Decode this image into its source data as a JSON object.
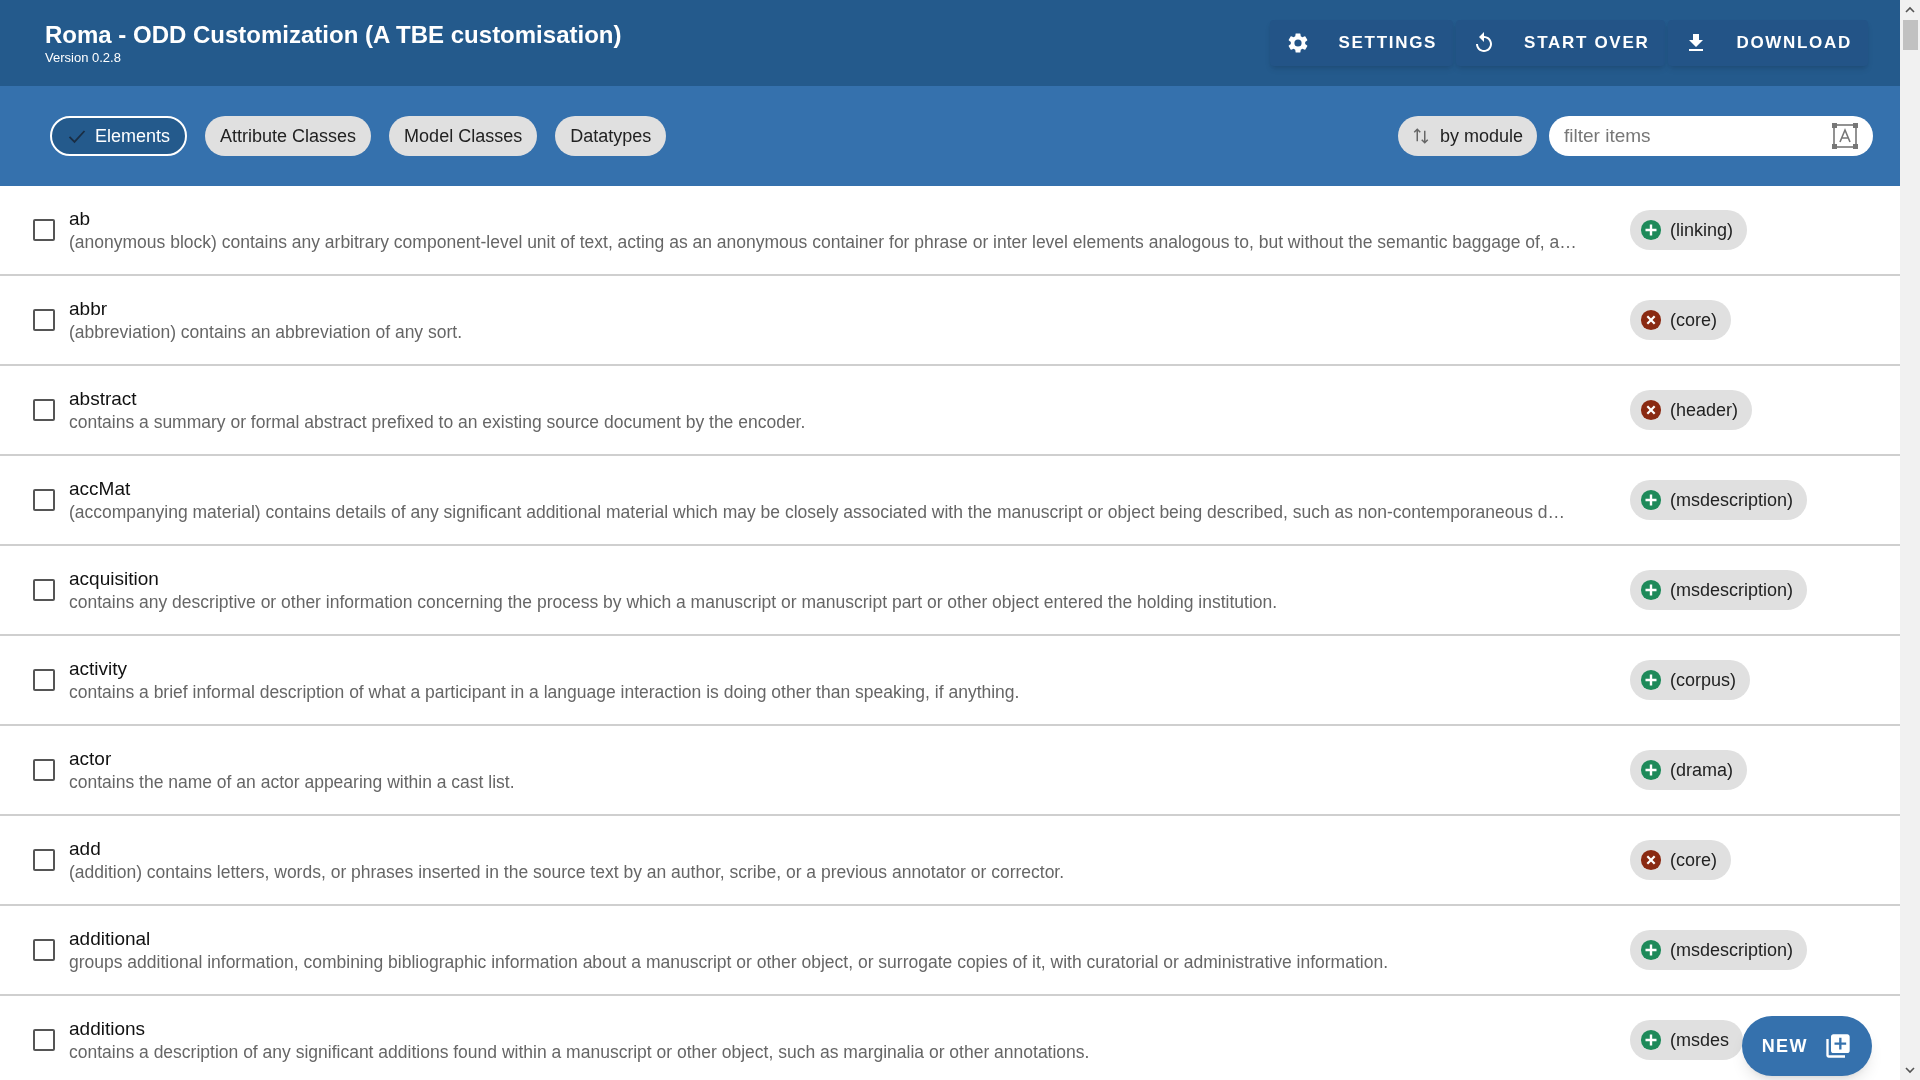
{
  "header": {
    "title": "Roma - ODD Customization (A TBE customisation)",
    "version": "Version 0.2.8",
    "actions": [
      {
        "kind": "settings",
        "label": "SETTINGS"
      },
      {
        "kind": "restart",
        "label": "START OVER"
      },
      {
        "kind": "download",
        "label": "DOWNLOAD"
      }
    ]
  },
  "toolbar": {
    "chips": [
      {
        "label": "Elements",
        "selected": true
      },
      {
        "label": "Attribute Classes",
        "selected": false
      },
      {
        "label": "Model Classes",
        "selected": false
      },
      {
        "label": "Datatypes",
        "selected": false
      }
    ],
    "sort": "by module",
    "filter": {
      "placeholder": "filter items"
    }
  },
  "items": [
    {
      "name": "ab",
      "description": "(anonymous block) contains any arbitrary component-level unit of text, acting as an anonymous container for phrase or inter level elements analogous to, but without the semantic baggage of, a…",
      "checked": false,
      "module": "(linking)",
      "kind": "included"
    },
    {
      "name": "abbr",
      "description": "(abbreviation) contains an abbreviation of any sort.",
      "checked": false,
      "module": "(core)",
      "kind": "excluded"
    },
    {
      "name": "abstract",
      "description": "contains a summary or formal abstract prefixed to an existing source document by the encoder.",
      "checked": false,
      "module": "(header)",
      "kind": "excluded"
    },
    {
      "name": "accMat",
      "description": "(accompanying material) contains details of any significant additional material which may be closely associated with the manuscript or object being described, such as non-contemporaneous d…",
      "checked": false,
      "module": "(msdescription)",
      "kind": "included"
    },
    {
      "name": "acquisition",
      "description": "contains any descriptive or other information concerning the process by which a manuscript or manuscript part or other object entered the holding institution.",
      "checked": false,
      "module": "(msdescription)",
      "kind": "included"
    },
    {
      "name": "activity",
      "description": "contains a brief informal description of what a participant in a language interaction is doing other than speaking, if anything.",
      "checked": false,
      "module": "(corpus)",
      "kind": "included"
    },
    {
      "name": "actor",
      "description": "contains the name of an actor appearing within a cast list.",
      "checked": false,
      "module": "(drama)",
      "kind": "included"
    },
    {
      "name": "add",
      "description": "(addition) contains letters, words, or phrases inserted in the source text by an author, scribe, or a previous annotator or corrector.",
      "checked": false,
      "module": "(core)",
      "kind": "excluded"
    },
    {
      "name": "additional",
      "description": "groups additional information, combining bibliographic information about a manuscript or other object, or surrogate copies of it, with curatorial or administrative information.",
      "checked": false,
      "module": "(msdescription)",
      "kind": "included"
    },
    {
      "name": "additions",
      "description": "contains a description of any significant additions found within a manuscript or other object, such as marginalia or other annotations.",
      "checked": false,
      "module": "(msdes",
      "kind": "included"
    }
  ],
  "fab": {
    "label": "NEW"
  }
}
